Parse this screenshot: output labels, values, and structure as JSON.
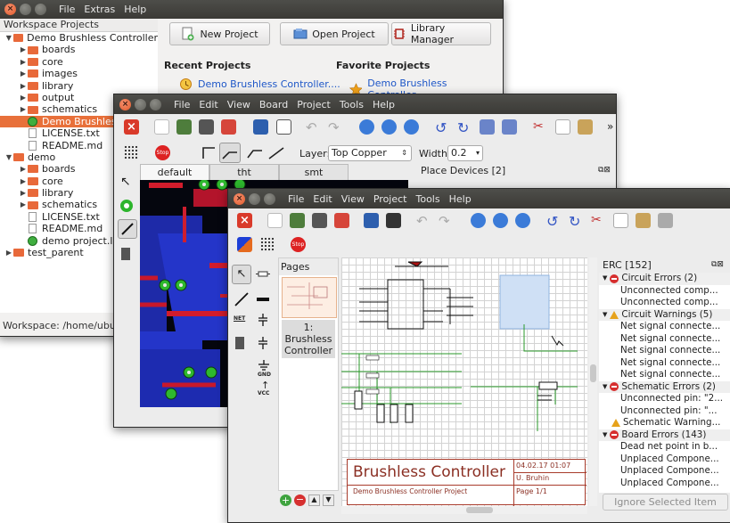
{
  "window_a": {
    "menu": [
      "File",
      "Extras",
      "Help"
    ],
    "tree_header": "Workspace Projects",
    "tree": [
      {
        "label": "Demo Brushless Controller",
        "type": "folder",
        "level": 0,
        "expanded": true
      },
      {
        "label": "boards",
        "type": "folder",
        "level": 1
      },
      {
        "label": "core",
        "type": "folder",
        "level": 1
      },
      {
        "label": "images",
        "type": "folder",
        "level": 1
      },
      {
        "label": "library",
        "type": "folder",
        "level": 1
      },
      {
        "label": "output",
        "type": "folder",
        "level": 1
      },
      {
        "label": "schematics",
        "type": "folder",
        "level": 1
      },
      {
        "label": "Demo Brushless",
        "type": "project",
        "level": 1,
        "selected": true
      },
      {
        "label": "LICENSE.txt",
        "type": "file",
        "level": 1
      },
      {
        "label": "README.md",
        "type": "file",
        "level": 1
      },
      {
        "label": "demo",
        "type": "folder",
        "level": 0,
        "expanded": true
      },
      {
        "label": "boards",
        "type": "folder",
        "level": 1
      },
      {
        "label": "core",
        "type": "folder",
        "level": 1
      },
      {
        "label": "library",
        "type": "folder",
        "level": 1
      },
      {
        "label": "schematics",
        "type": "folder",
        "level": 1
      },
      {
        "label": "LICENSE.txt",
        "type": "file",
        "level": 1
      },
      {
        "label": "README.md",
        "type": "file",
        "level": 1
      },
      {
        "label": "demo project.lpp",
        "type": "project",
        "level": 1
      },
      {
        "label": "test_parent",
        "type": "folder",
        "level": 0
      }
    ],
    "status": "Workspace: /home/ubuntu",
    "buttons": {
      "new": "New Project",
      "open": "Open Project",
      "library": "Library Manager"
    },
    "recent_title": "Recent Projects",
    "favorite_title": "Favorite Projects",
    "recent_item": "Demo Brushless Controller....",
    "favorite_item": "Demo Brushless Controller...."
  },
  "window_b": {
    "menu": [
      "File",
      "Edit",
      "View",
      "Board",
      "Project",
      "Tools",
      "Help"
    ],
    "layer_label": "Layer:",
    "layer_value": "Top Copper",
    "width_label": "Width:",
    "width_value": "0.2",
    "tabs": [
      "default",
      "tht",
      "smt"
    ],
    "place_devices": "Place Devices [2]",
    "overflow": "»"
  },
  "window_c": {
    "menu": [
      "File",
      "Edit",
      "View",
      "Project",
      "Tools",
      "Help"
    ],
    "pages_title": "Pages",
    "page_item": "1: Brushless Controller",
    "title_block": {
      "title": "Brushless Controller",
      "subtitle": "Demo Brushless Controller Project",
      "date": "04.02.17 01:07",
      "author": "U. Bruhin",
      "page": "Page 1/1"
    },
    "erc_title": "ERC [152]",
    "erc": [
      {
        "text": "Circuit Errors (2)",
        "kind": "cat-error"
      },
      {
        "text": "Unconnected comp...",
        "kind": "item"
      },
      {
        "text": "Unconnected comp...",
        "kind": "item"
      },
      {
        "text": "Circuit Warnings (5)",
        "kind": "cat-warn"
      },
      {
        "text": "Net signal connecte...",
        "kind": "item"
      },
      {
        "text": "Net signal connecte...",
        "kind": "item"
      },
      {
        "text": "Net signal connecte...",
        "kind": "item"
      },
      {
        "text": "Net signal connecte...",
        "kind": "item"
      },
      {
        "text": "Net signal connecte...",
        "kind": "item"
      },
      {
        "text": "Schematic Errors (2)",
        "kind": "cat-error"
      },
      {
        "text": "Unconnected pin: \"2...",
        "kind": "item"
      },
      {
        "text": "Unconnected pin: \"...",
        "kind": "item"
      },
      {
        "text": "Schematic Warning...",
        "kind": "warn-item"
      },
      {
        "text": "Board Errors (143)",
        "kind": "cat-error"
      },
      {
        "text": "Dead net point in b...",
        "kind": "item"
      },
      {
        "text": "Unplaced Compone...",
        "kind": "item"
      },
      {
        "text": "Unplaced Compone...",
        "kind": "item"
      },
      {
        "text": "Unplaced Compone...",
        "kind": "item"
      }
    ],
    "ignore_button": "Ignore Selected Item",
    "tool_labels": {
      "net": "NET",
      "gnd": "GND",
      "vcc": "VCC"
    }
  }
}
